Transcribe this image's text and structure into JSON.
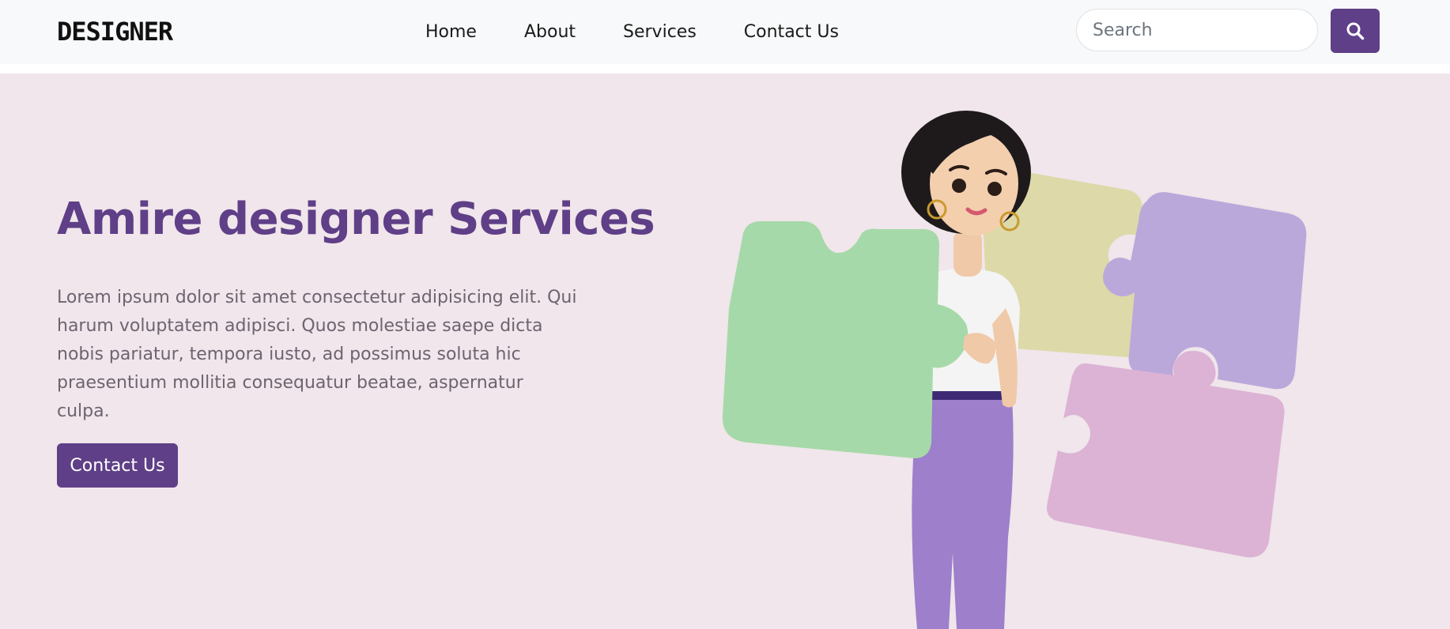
{
  "brand": {
    "logo_text": "DESIGNER"
  },
  "nav": {
    "links": [
      {
        "label": "Home"
      },
      {
        "label": "About"
      },
      {
        "label": "Services"
      },
      {
        "label": "Contact Us"
      }
    ]
  },
  "search": {
    "placeholder": "Search",
    "icon": "search-icon"
  },
  "hero": {
    "title": "Amire designer Services",
    "body": "Lorem ipsum dolor sit amet consectetur adipisicing elit. Qui harum voluptatem adipisci. Quos molestiae saepe dicta nobis pariatur, tempora iusto, ad possimus soluta hic praesentium mollitia consequatur beatae, aspernatur culpa.",
    "cta_label": "Contact Us",
    "illustration": "woman-holding-puzzle-pieces"
  },
  "colors": {
    "accent": "#5f3f87",
    "background": "#f0e6eb",
    "navbar": "#f8f9fa",
    "text_muted": "#6c6470"
  }
}
